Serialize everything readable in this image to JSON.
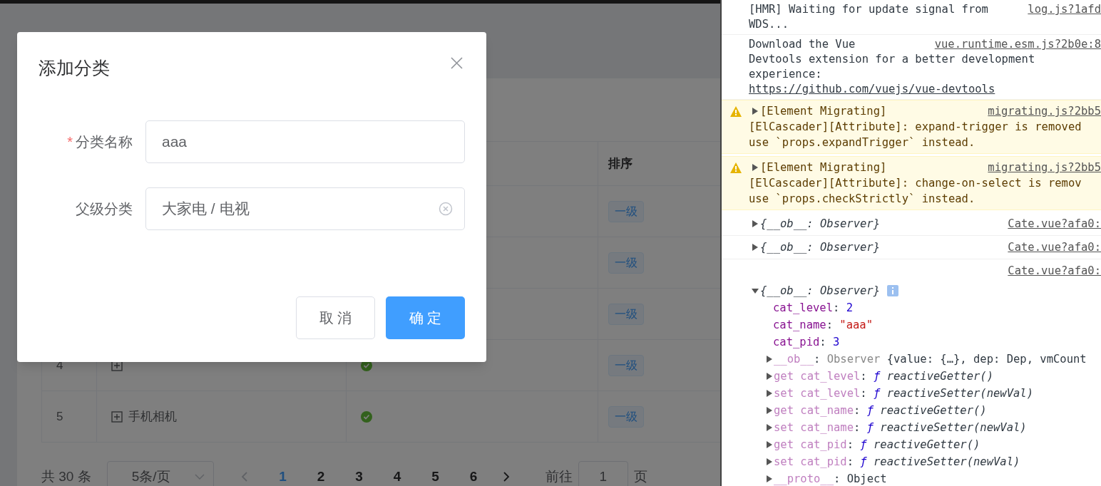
{
  "table": {
    "columns": [
      {
        "label": "排序"
      }
    ],
    "rows": [
      {
        "level_tag": "一级"
      },
      {
        "level_tag": "一级"
      },
      {
        "level_tag": "一级"
      },
      {
        "index": "4",
        "expandable": true,
        "valid": true,
        "level_tag": "一级"
      },
      {
        "index": "5",
        "expandable": true,
        "name": "手机相机",
        "valid": true,
        "level_tag": "一级"
      }
    ]
  },
  "pagination": {
    "total": "共 30 条",
    "page_size": "5条/页",
    "prev_disabled": true,
    "pages": [
      {
        "label": "1",
        "selected": true
      },
      {
        "label": "2",
        "selected": false
      },
      {
        "label": "3",
        "selected": false
      },
      {
        "label": "4",
        "selected": false
      },
      {
        "label": "5",
        "selected": false
      },
      {
        "label": "6",
        "selected": false
      }
    ],
    "goto_label": "前往",
    "goto_value": "1",
    "goto_suffix": "页"
  },
  "dialog": {
    "title": "添加分类",
    "fields": [
      {
        "label": "分类名称",
        "required": true,
        "required_mark": "*",
        "value": "aaa",
        "clearable": false
      },
      {
        "label": "父级分类",
        "required": false,
        "value": "大家电 / 电视",
        "clearable": true
      }
    ],
    "buttons": [
      {
        "label": "取 消",
        "kind": "default"
      },
      {
        "label": "确 定",
        "kind": "primary"
      }
    ]
  },
  "console": {
    "messages": [
      {
        "kind": "log",
        "lines": [
          "[HMR] Waiting for update signal from",
          "WDS..."
        ],
        "source": "log.js?1afd"
      },
      {
        "kind": "log",
        "lines": [
          "Download the Vue",
          "Devtools extension for a better development",
          "experience:"
        ],
        "link": "https://github.com/vuejs/vue-devtools",
        "source": "vue.runtime.esm.js?2b0e:8"
      },
      {
        "kind": "warning",
        "lines": [
          "[Element Migrating]",
          "[ElCascader][Attribute]: expand-trigger is removed",
          "use `props.expandTrigger` instead."
        ],
        "source": "migrating.js?2bb5"
      },
      {
        "kind": "warning",
        "lines": [
          "[Element Migrating]",
          "[ElCascader][Attribute]: change-on-select is remov",
          "use `props.checkStrictly` instead."
        ],
        "source": "migrating.js?2bb5"
      },
      {
        "kind": "object",
        "text": "{__ob__: Observer}",
        "source": "Cate.vue?afa0:",
        "expanded": false
      },
      {
        "kind": "object",
        "text": "{__ob__: Observer}",
        "source": "Cate.vue?afa0:",
        "expanded": false
      },
      {
        "kind": "object",
        "text": "{__ob__: Observer}",
        "source": "Cate.vue?afa0:",
        "expanded": true,
        "props": [
          {
            "key": "cat_level",
            "sep": ":",
            "value": "2",
            "kind": "number"
          },
          {
            "key": "cat_name",
            "sep": ":",
            "value": "\"aaa\"",
            "kind": "string"
          },
          {
            "key": "cat_pid",
            "sep": ":",
            "value": "3",
            "kind": "number"
          }
        ],
        "children": [
          {
            "key": "__ob__",
            "sep": ":",
            "kind": "instance",
            "class_name": "Observer",
            "value": "{value: {…}, dep: Dep, vmCount"
          },
          {
            "key": "get cat_level",
            "sep": ":",
            "kind": "function",
            "symbol": "ƒ",
            "value": "reactiveGetter()"
          },
          {
            "key": "set cat_level",
            "sep": ":",
            "kind": "function",
            "symbol": "ƒ",
            "value": "reactiveSetter(newVal)"
          },
          {
            "key": "get cat_name",
            "sep": ":",
            "kind": "function",
            "symbol": "ƒ",
            "value": "reactiveGetter()"
          },
          {
            "key": "set cat_name",
            "sep": ":",
            "kind": "function",
            "symbol": "ƒ",
            "value": "reactiveSetter(newVal)"
          },
          {
            "key": "get cat_pid",
            "sep": ":",
            "kind": "function",
            "symbol": "ƒ",
            "value": "reactiveGetter()"
          },
          {
            "key": "set cat_pid",
            "sep": ":",
            "kind": "function",
            "symbol": "ƒ",
            "value": "reactiveSetter(newVal)"
          },
          {
            "key": "__proto__",
            "sep": ":",
            "kind": "plain",
            "value": "Object"
          }
        ]
      }
    ]
  }
}
